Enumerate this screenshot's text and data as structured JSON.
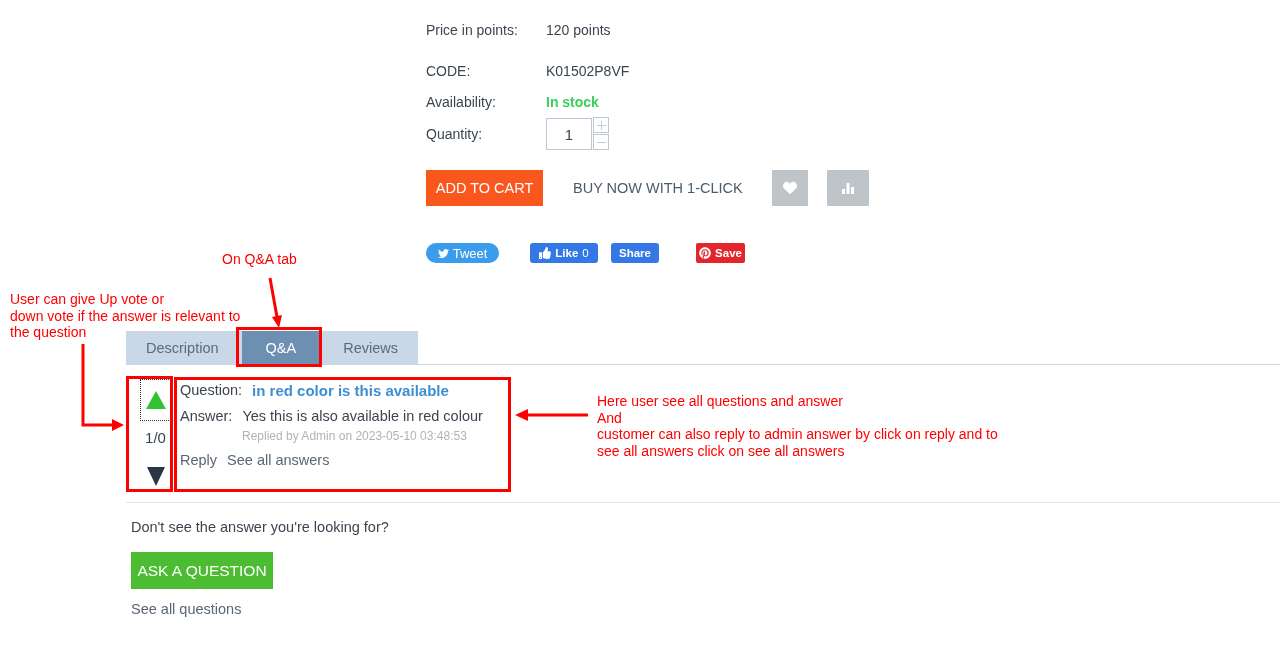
{
  "product": {
    "price": {
      "label": "Price in points:",
      "value": "120 points"
    },
    "details": [
      {
        "label": "CODE:",
        "value": "K01502P8VF",
        "kind": "text"
      },
      {
        "label": "Availability:",
        "value": "In stock",
        "kind": "status"
      }
    ],
    "quantity": {
      "label": "Quantity:",
      "value": "1"
    },
    "add_to_cart": "ADD TO CART",
    "buy_now": "BUY NOW WITH 1-CLICK"
  },
  "social": [
    {
      "kind": "tweet",
      "label": "Tweet"
    },
    {
      "kind": "like",
      "label": "Like",
      "count": "0"
    },
    {
      "kind": "share",
      "label": "Share"
    },
    {
      "kind": "save",
      "label": "Save"
    }
  ],
  "tabs": [
    {
      "label": "Description",
      "selected": false
    },
    {
      "label": "Q&A",
      "selected": true
    },
    {
      "label": "Reviews",
      "selected": false
    }
  ],
  "qa": {
    "items": [
      {
        "votes": "1/0",
        "up_focused": true,
        "down_focused": false,
        "question_label": "Question:",
        "question": "in red color is this available",
        "answer_label": "Answer:",
        "answer": "Yes this is also available in red colour",
        "meta": "Replied by Admin on 2023-05-10 03:48:53",
        "links": [
          "Reply",
          "See all answers"
        ]
      }
    ],
    "prompt": "Don't see the answer you're looking for?",
    "ask_button": "ASK A QUESTION",
    "see_all": "See all questions"
  },
  "annotations": {
    "notes": [
      {
        "lines": [
          "On Q&A tab"
        ]
      },
      {
        "lines": [
          "User can give Up vote or",
          "down vote if the answer is relevant to",
          "the question"
        ]
      },
      {
        "lines": [
          "Here user see all questions and answer",
          "And",
          "customer can also reply to admin answer by click on reply and to",
          "see all answers click on see all answers"
        ]
      }
    ]
  }
}
